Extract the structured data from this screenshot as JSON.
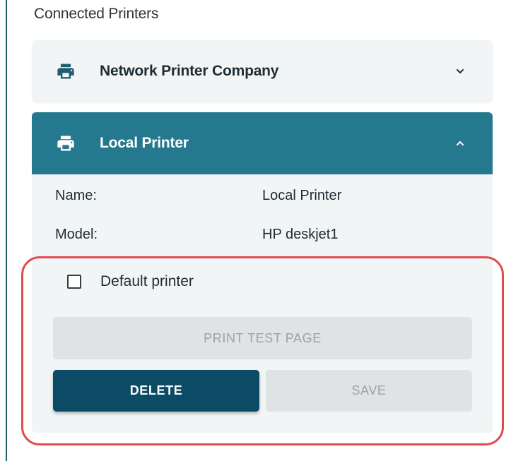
{
  "section": {
    "title": "Connected Printers"
  },
  "printers": [
    {
      "name": "Network Printer Company",
      "icon": "printer-icon",
      "expanded": false,
      "chevron": "chevron-down-icon"
    },
    {
      "name": "Local Printer",
      "icon": "printer-alert-icon",
      "expanded": true,
      "chevron": "chevron-up-icon",
      "details": {
        "name_label": "Name:",
        "name_value": "Local Printer",
        "model_label": "Model:",
        "model_value": "HP deskjet1"
      },
      "default_checkbox": {
        "label": "Default printer",
        "checked": false
      },
      "buttons": {
        "print_test": "PRINT TEST PAGE",
        "delete": "DELETE",
        "save": "SAVE"
      }
    }
  ],
  "colors": {
    "header_active": "#25798f",
    "delete_button": "#0b4b66",
    "panel_bg": "#f1f5f6",
    "disabled_button": "#dfe3e5",
    "highlight_outline": "#e34a4f"
  }
}
